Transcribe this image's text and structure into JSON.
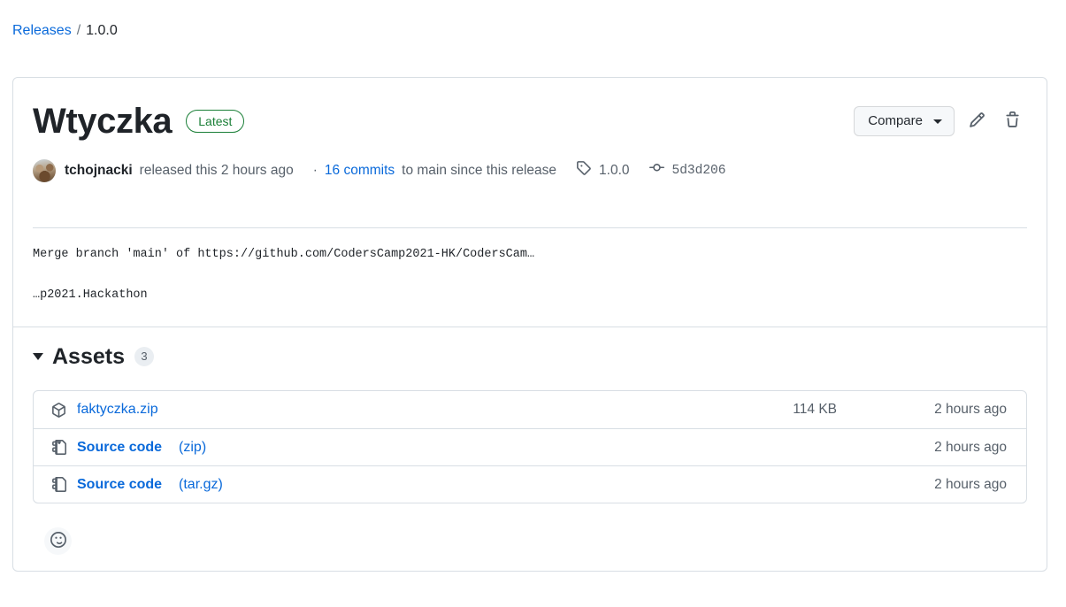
{
  "breadcrumb": {
    "releases_label": "Releases",
    "separator": "/",
    "current": "1.0.0"
  },
  "release": {
    "title": "Wtyczka",
    "latest_badge": "Latest",
    "actions": {
      "compare_label": "Compare",
      "edit_icon": "pencil-icon",
      "delete_icon": "trash-icon"
    },
    "meta": {
      "author": "tchojnacki",
      "released_text": "released this 2 hours ago",
      "dot": "·",
      "commits_link": "16 commits",
      "commits_suffix": "to main since this release",
      "tag_icon": "tag-icon",
      "tag_name": "1.0.0",
      "commit_icon": "commit-icon",
      "commit_sha": "5d3d206"
    },
    "body": {
      "line1": "Merge branch 'main' of https://github.com/CodersCamp2021-HK/CodersCam…",
      "line2": "…p2021.Hackathon"
    }
  },
  "assets": {
    "title": "Assets",
    "count": "3",
    "rows": [
      {
        "icon": "package-icon",
        "name": "faktyczka.zip",
        "suffix": "",
        "size": "114 KB",
        "date": "2 hours ago"
      },
      {
        "icon": "file-zip-icon",
        "name": "Source code",
        "suffix": "(zip)",
        "size": "",
        "date": "2 hours ago"
      },
      {
        "icon": "file-zip-icon",
        "name": "Source code",
        "suffix": "(tar.gz)",
        "size": "",
        "date": "2 hours ago"
      }
    ]
  },
  "reaction": {
    "icon": "smiley-icon"
  },
  "colors": {
    "link": "#0969da",
    "success": "#1a7f37",
    "border": "#d8dee4",
    "muted": "#57606a",
    "button_bg": "#f6f8fa"
  }
}
